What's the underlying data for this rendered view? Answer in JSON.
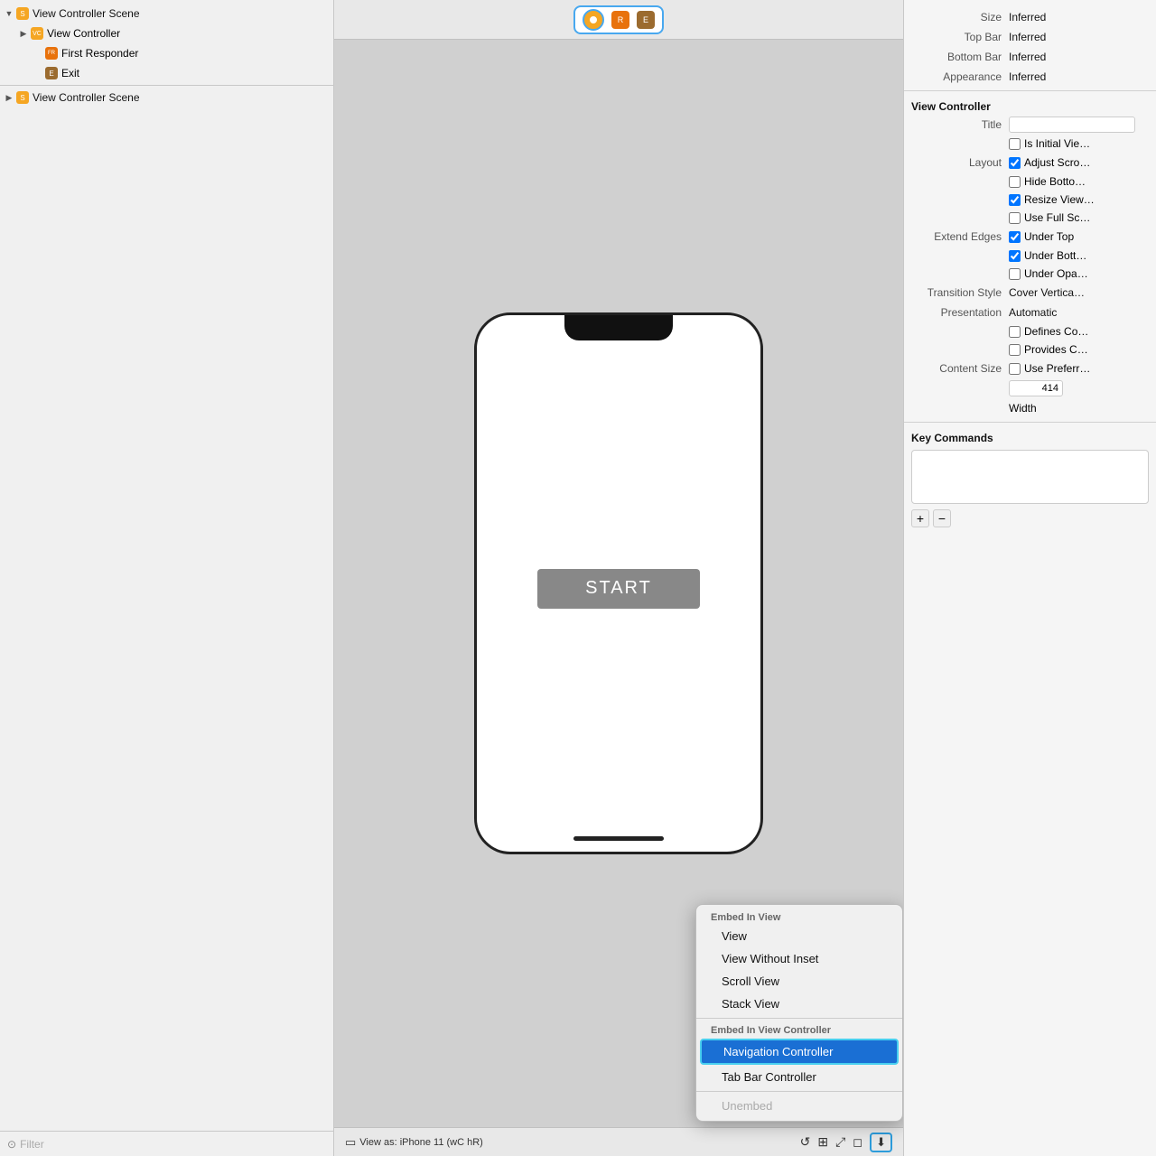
{
  "leftPanel": {
    "scenes": [
      {
        "label": "View Controller Scene",
        "expanded": true,
        "level": 0,
        "iconType": "yellow",
        "iconLabel": "S",
        "children": [
          {
            "label": "View Controller",
            "level": 1,
            "iconType": "yellow",
            "iconLabel": "VC",
            "expanded": true
          },
          {
            "label": "First Responder",
            "level": 2,
            "iconType": "orange",
            "iconLabel": "FR"
          },
          {
            "label": "Exit",
            "level": 2,
            "iconType": "brown",
            "iconLabel": "E"
          }
        ]
      },
      {
        "label": "View Controller Scene",
        "expanded": false,
        "level": 0,
        "iconType": "yellow",
        "iconLabel": "S"
      }
    ],
    "filter": {
      "placeholder": "Filter",
      "icon": "🔍"
    }
  },
  "canvas": {
    "phoneButton": {
      "startLabel": "START"
    },
    "statusBar": {
      "text": "View as: iPhone 11 (wC hR)"
    }
  },
  "rightPanel": {
    "simulated": {
      "size": "Inferred",
      "topBar": "Inferred",
      "bottomBar": "Inferred",
      "appearance": "Inferred"
    },
    "viewController": {
      "sectionLabel": "View Controller",
      "titleLabel": "Title",
      "titleValue": "",
      "isInitialView": false,
      "layout": {
        "adjustScroll": true,
        "hideBottom": false,
        "resizeView": true,
        "useFullScreen": false
      },
      "extendEdges": {
        "underTop": true,
        "underBottom": true,
        "underOpaque": false
      },
      "transitionStyle": "Cover Vertica…",
      "presentation": "Automatic",
      "definesCo": false,
      "providesCo": false,
      "contentSize": {
        "usePrefer": false,
        "widthValue": "414",
        "widthLabel": "Width"
      }
    },
    "keyCommands": {
      "sectionLabel": "Key Commands",
      "addLabel": "+",
      "removeLabel": "−"
    }
  },
  "dropdownMenu": {
    "embedInViewLabel": "Embed In View",
    "items": [
      {
        "label": "View",
        "disabled": false,
        "selected": false
      },
      {
        "label": "View Without Inset",
        "disabled": false,
        "selected": false
      },
      {
        "label": "Scroll View",
        "disabled": false,
        "selected": false
      },
      {
        "label": "Stack View",
        "disabled": false,
        "selected": false
      }
    ],
    "embedInViewControllerLabel": "Embed In View Controller",
    "controllerItems": [
      {
        "label": "Navigation Controller",
        "disabled": false,
        "selected": true
      },
      {
        "label": "Tab Bar Controller",
        "disabled": false,
        "selected": false
      }
    ],
    "unembed": {
      "label": "Unembed",
      "disabled": true
    }
  }
}
